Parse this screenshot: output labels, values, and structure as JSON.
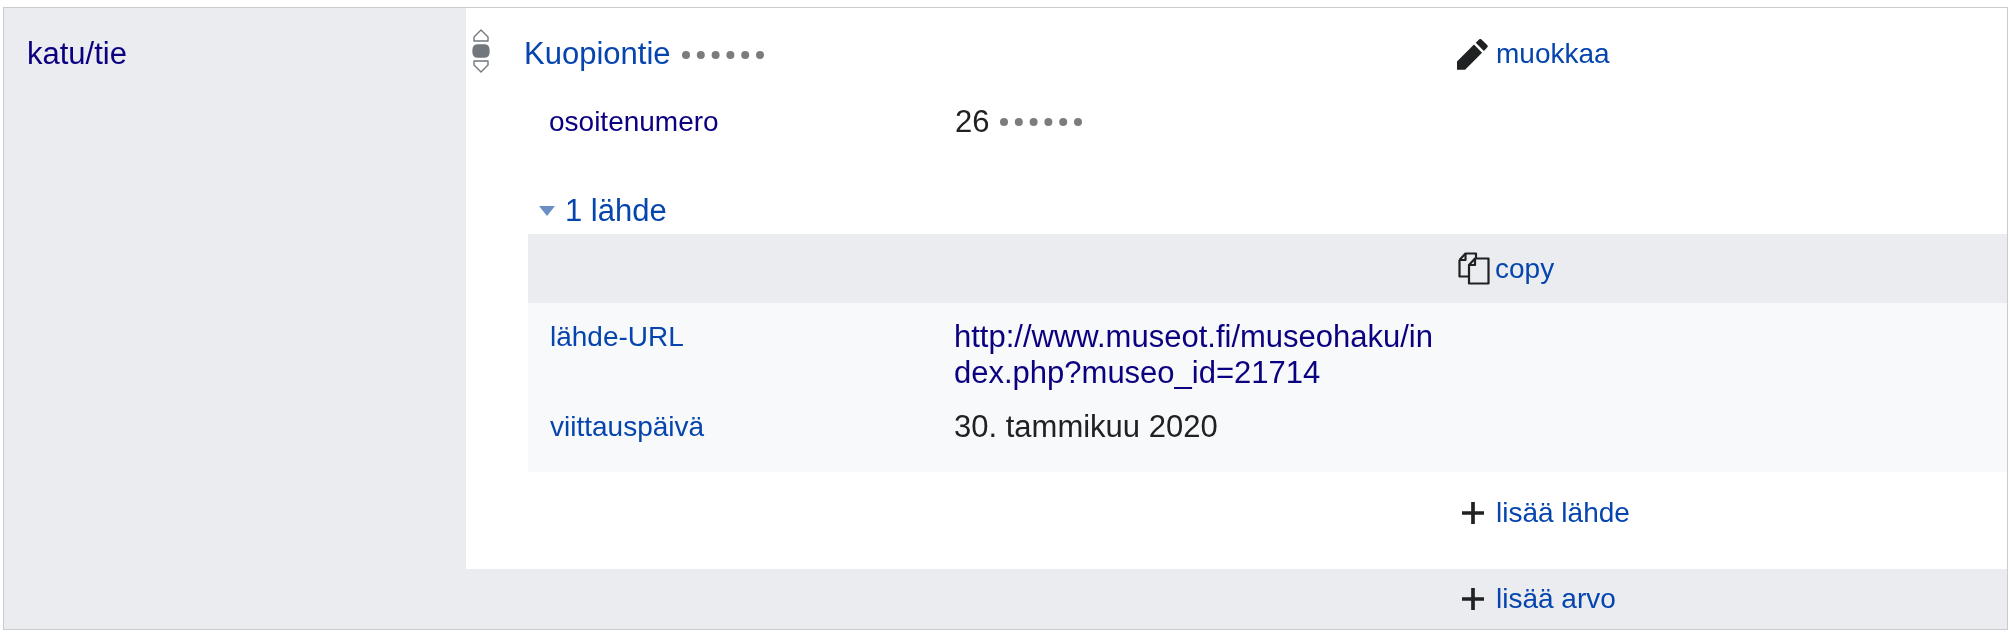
{
  "statement_group": {
    "property": {
      "label": "katu/tie",
      "visited": true
    },
    "statements": [
      {
        "rank": [
          {
            "kind": "preferred",
            "selected": false
          },
          {
            "kind": "normal",
            "selected": true
          },
          {
            "kind": "deprecated",
            "selected": false
          }
        ],
        "value": {
          "text": "Kuopiontie",
          "visited": false
        },
        "edit_link": "muokkaa",
        "qualifiers": [
          {
            "property": {
              "label": "osoitenumero",
              "visited": true
            },
            "value": "26"
          }
        ],
        "references": {
          "toggle": "1 lähde",
          "expanded": true,
          "items": [
            {
              "copy_link": "copy",
              "snaks": [
                {
                  "property": {
                    "label": "lähde-URL",
                    "visited": false
                  },
                  "value": {
                    "text": "http://www.museot.fi/museohaku/index.php?museo_id=21714",
                    "kind": "link"
                  }
                },
                {
                  "property": {
                    "label": "viittauspäivä",
                    "visited": false
                  },
                  "value": {
                    "text": "30. tammikuu 2020",
                    "kind": "text"
                  }
                }
              ]
            }
          ],
          "add_link": "lisää lähde"
        }
      }
    ],
    "add_value": "lisää arvo"
  }
}
